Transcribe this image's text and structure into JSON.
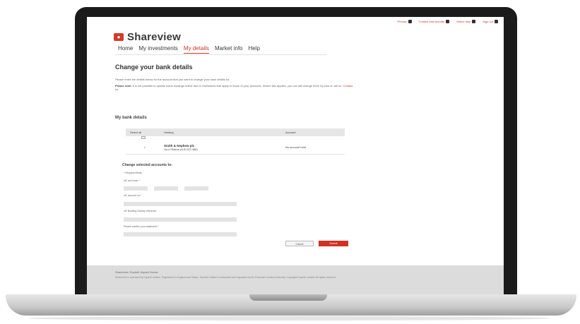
{
  "top_links": [
    "Privacy",
    "Contact and security",
    "Online help",
    "Sign out"
  ],
  "brand": {
    "name": "Shareview"
  },
  "nav": [
    "Home",
    "My investments",
    "My details",
    "Market info",
    "Help"
  ],
  "page": {
    "title": "Change your bank details",
    "intro": "Please enter the details below for the account that you want to change your bank details for.",
    "notice_label": "Please note:",
    "notice_text": "it is not possible to update some holdings online due to restrictions that apply to those of your accounts. Where this applies, you can still change them by post or call us.",
    "notice_link": "Contact us"
  },
  "bank_section": {
    "title": "My bank details",
    "columns": [
      "Select all",
      "Holding",
      "Account"
    ],
    "rows": [
      {
        "select": "✓",
        "holding_name": "Smith & Nephew plc",
        "holding_ref": "Your Shares (A.B.123 456)",
        "account": "No account held"
      }
    ]
  },
  "form": {
    "title": "Change selected accounts to:",
    "required_note": "* Required fields",
    "sort_code_label": "UK sort code *",
    "account_number_label": "UK account no *",
    "society_label": "UK Building Society reference",
    "confirm_label": "Please confirm your statement *",
    "cancel_label": "Cancel",
    "submit_label": "Submit"
  },
  "footer": {
    "title": "Shareview, Equiniti, Aspect House",
    "text": "Shareview is operated by Equiniti Limited. Registered in England and Wales. Equiniti Limited is authorised and regulated by the Financial Conduct Authority. Copyright Equiniti Limited. All rights reserved."
  }
}
